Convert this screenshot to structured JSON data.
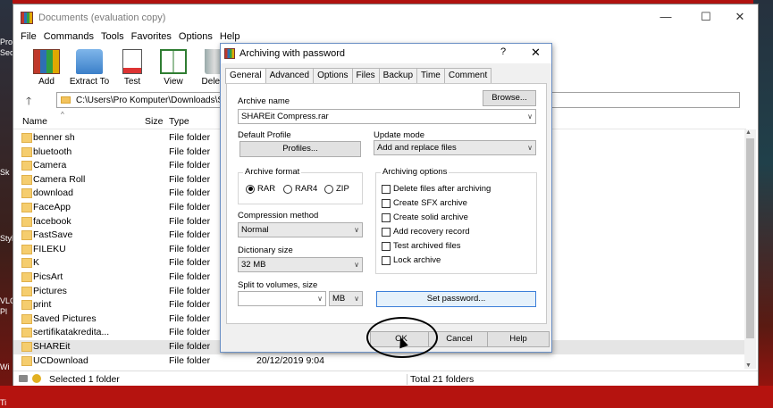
{
  "desktop": {
    "labels": [
      "Pro",
      "Sec",
      "Sk",
      "Style",
      "VLC",
      "Pl",
      "Wi",
      "Ti"
    ]
  },
  "window": {
    "title": "Documents (evaluation copy)",
    "menu": [
      "File",
      "Commands",
      "Tools",
      "Favorites",
      "Options",
      "Help"
    ],
    "toolbar": [
      "Add",
      "Extract To",
      "Test",
      "View",
      "Delete"
    ],
    "address": "C:\\Users\\Pro Komputer\\Downloads\\S",
    "columns": {
      "name": "Name",
      "size": "Size",
      "type": "Type"
    },
    "files": [
      {
        "name": "benner sh",
        "type": "File folder",
        "date": ""
      },
      {
        "name": "bluetooth",
        "type": "File folder",
        "date": ""
      },
      {
        "name": "Camera",
        "type": "File folder",
        "date": ""
      },
      {
        "name": "Camera Roll",
        "type": "File folder",
        "date": ""
      },
      {
        "name": "download",
        "type": "File folder",
        "date": ""
      },
      {
        "name": "FaceApp",
        "type": "File folder",
        "date": ""
      },
      {
        "name": "facebook",
        "type": "File folder",
        "date": ""
      },
      {
        "name": "FastSave",
        "type": "File folder",
        "date": ""
      },
      {
        "name": "FILEKU",
        "type": "File folder",
        "date": ""
      },
      {
        "name": "K",
        "type": "File folder",
        "date": ""
      },
      {
        "name": "PicsArt",
        "type": "File folder",
        "date": ""
      },
      {
        "name": "Pictures",
        "type": "File folder",
        "date": ""
      },
      {
        "name": "print",
        "type": "File folder",
        "date": ""
      },
      {
        "name": "Saved Pictures",
        "type": "File folder",
        "date": ""
      },
      {
        "name": "sertifikatakredita...",
        "type": "File folder",
        "date": ""
      },
      {
        "name": "SHAREit",
        "type": "File folder",
        "date": "",
        "selected": true
      },
      {
        "name": "UCDownload",
        "type": "File folder",
        "date": "20/12/2019 9:04"
      }
    ],
    "status_left": "Selected 1 folder",
    "status_right": "Total 21 folders"
  },
  "dialog": {
    "title": "Archiving with password",
    "help_glyph": "?",
    "close_glyph": "✕",
    "tabs": [
      "General",
      "Advanced",
      "Options",
      "Files",
      "Backup",
      "Time",
      "Comment"
    ],
    "active_tab": "General",
    "archive_name_label": "Archive name",
    "browse_label": "Browse...",
    "archive_name_value": "SHAREit Compress.rar",
    "default_profile_label": "Default Profile",
    "profiles_label": "Profiles...",
    "update_mode_label": "Update mode",
    "update_mode_value": "Add and replace files",
    "archive_format_label": "Archive format",
    "formats": [
      "RAR",
      "RAR4",
      "ZIP"
    ],
    "selected_format": "RAR",
    "compression_method_label": "Compression method",
    "compression_method_value": "Normal",
    "dictionary_size_label": "Dictionary size",
    "dictionary_size_value": "32 MB",
    "split_label": "Split to volumes, size",
    "split_value": "",
    "split_unit": "MB",
    "archiving_options_label": "Archiving options",
    "options": [
      {
        "label": "Delete files after archiving",
        "checked": false
      },
      {
        "label": "Create SFX archive",
        "checked": false
      },
      {
        "label": "Create solid archive",
        "checked": false
      },
      {
        "label": "Add recovery record",
        "checked": false
      },
      {
        "label": "Test archived files",
        "checked": false
      },
      {
        "label": "Lock archive",
        "checked": false
      }
    ],
    "set_password_label": "Set password...",
    "ok_label": "OK",
    "cancel_label": "Cancel",
    "help_label": "Help"
  }
}
